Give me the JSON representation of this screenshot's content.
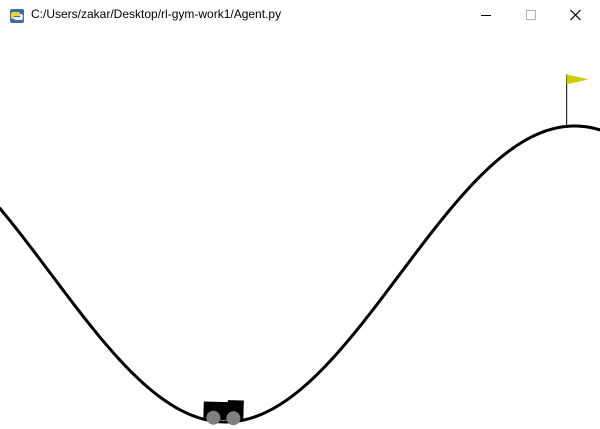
{
  "window": {
    "title": "C:/Users/zakar/Desktop/rl-gym-work1/Agent.py",
    "app_icon": "python-icon",
    "controls": {
      "minimize_icon": "minimize-icon",
      "maximize_icon": "maximize-icon",
      "close_icon": "close-icon"
    }
  },
  "scene": {
    "environment": "MountainCar",
    "terrain_color": "#000000",
    "car_color": "#000000",
    "wheel_color": "#808080",
    "flag_color": "#cccc00",
    "flagpole_color": "#000000",
    "car_position": -0.53,
    "goal_position": 0.5
  }
}
